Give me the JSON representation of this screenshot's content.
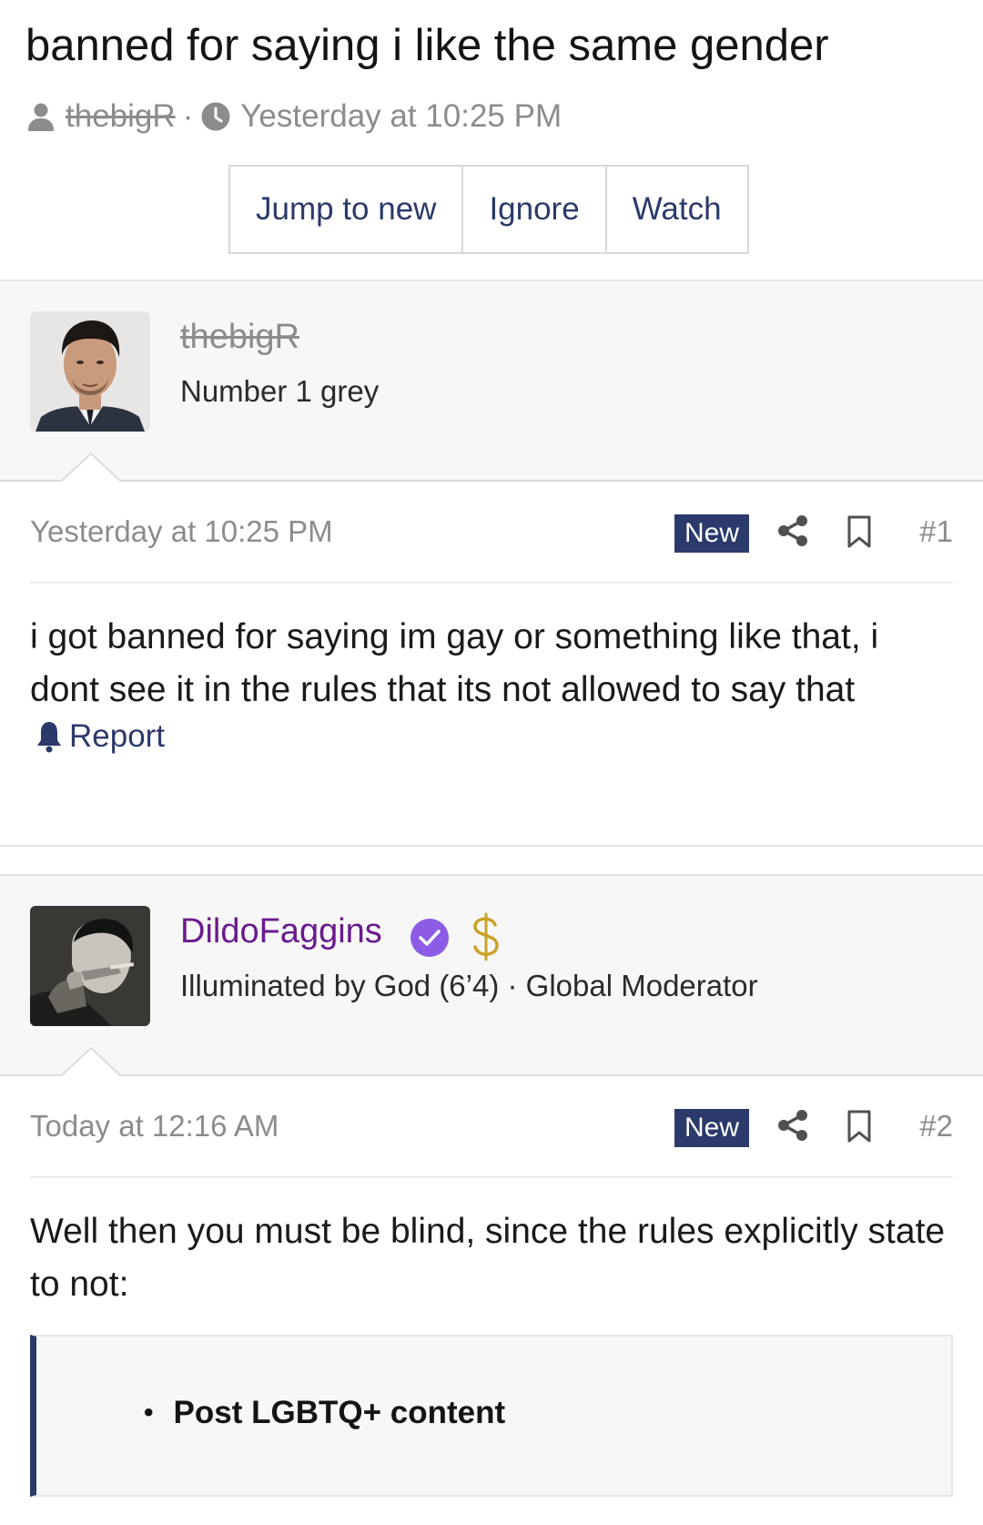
{
  "thread": {
    "title": "banned for saying i like the same gender",
    "author": "thebigR",
    "separator": "·",
    "time": "Yesterday at 10:25 PM",
    "buttons": [
      "Jump to new",
      "Ignore",
      "Watch"
    ]
  },
  "posts": [
    {
      "username": "thebigR",
      "user_title": "Number 1 grey",
      "time": "Yesterday at 10:25 PM",
      "badge": "New",
      "number": "#1",
      "body": "i got banned for saying im gay or something like that, i dont see it in the rules that its not allowed to say that",
      "report_label": "Report"
    },
    {
      "username": "DildoFaggins",
      "user_title": "Illuminated by God (6’4) · Global Moderator",
      "time": "Today at 12:16 AM",
      "badge": "New",
      "number": "#2",
      "body": "Well then you must be blind, since the rules explicitly state to not:",
      "quote_item": "Post LGBTQ+ content"
    }
  ],
  "colors": {
    "accent": "#2b3a6b",
    "moderator_name": "#6a1a8c",
    "muted": "#8c8c8c"
  },
  "icons": [
    "user-icon",
    "clock-icon",
    "share-icon",
    "bookmark-icon",
    "bell-icon",
    "verified-icon",
    "dollar-icon"
  ]
}
